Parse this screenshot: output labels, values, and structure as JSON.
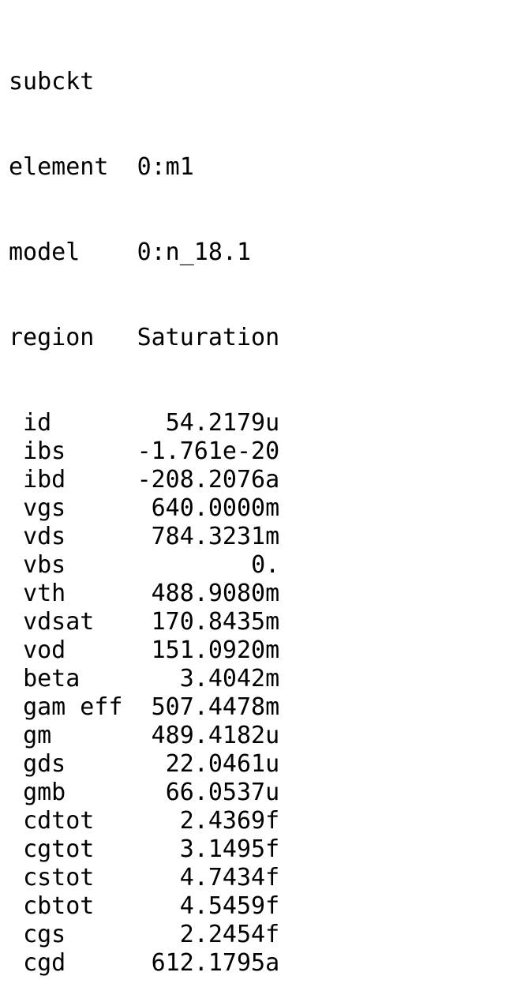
{
  "header": [
    {
      "label": "subckt",
      "value": ""
    },
    {
      "label": "element",
      "value": "0:m1"
    },
    {
      "label": "model",
      "value": "0:n_18.1"
    },
    {
      "label": "region",
      "value": "Saturation"
    }
  ],
  "params": [
    {
      "name": "id",
      "value": "54.2179u"
    },
    {
      "name": "ibs",
      "value": "-1.761e-20"
    },
    {
      "name": "ibd",
      "value": "-208.2076a"
    },
    {
      "name": "vgs",
      "value": "640.0000m"
    },
    {
      "name": "vds",
      "value": "784.3231m"
    },
    {
      "name": "vbs",
      "value": "0."
    },
    {
      "name": "vth",
      "value": "488.9080m"
    },
    {
      "name": "vdsat",
      "value": "170.8435m"
    },
    {
      "name": "vod",
      "value": "151.0920m"
    },
    {
      "name": "beta",
      "value": "3.4042m"
    },
    {
      "name": "gam eff",
      "value": "507.4478m"
    },
    {
      "name": "gm",
      "value": "489.4182u"
    },
    {
      "name": "gds",
      "value": "22.0461u"
    },
    {
      "name": "gmb",
      "value": "66.0537u"
    },
    {
      "name": "cdtot",
      "value": "2.4369f"
    },
    {
      "name": "cgtot",
      "value": "3.1495f"
    },
    {
      "name": "cstot",
      "value": "4.7434f"
    },
    {
      "name": "cbtot",
      "value": "4.5459f"
    },
    {
      "name": "cgs",
      "value": "2.2454f"
    },
    {
      "name": "cgd",
      "value": "612.1795a"
    }
  ]
}
